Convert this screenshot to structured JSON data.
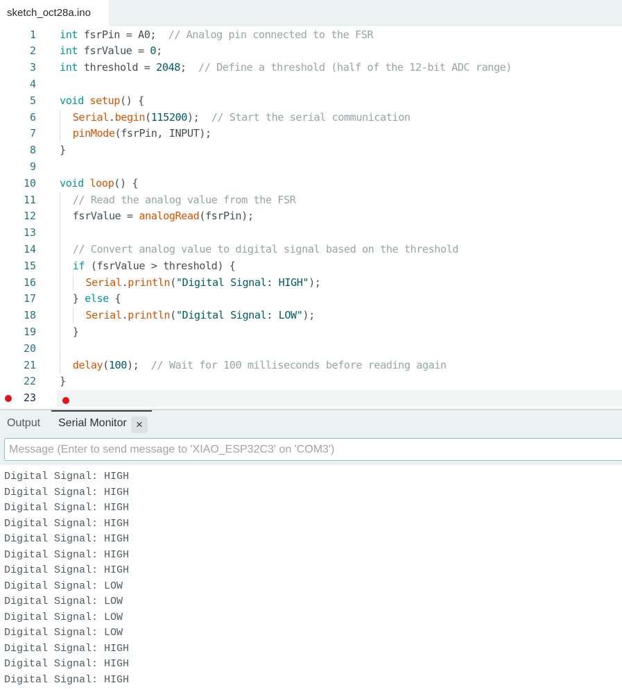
{
  "file_tab": {
    "label": "sketch_oct28a.ino"
  },
  "editor": {
    "active_line": 23,
    "breakpoint_line": 23,
    "lines": [
      {
        "n": "1",
        "tokens": [
          [
            "kw",
            "int"
          ],
          [
            "plain",
            " fsrPin = A0;  "
          ],
          [
            "cm",
            "// Analog pin connected to the FSR"
          ]
        ]
      },
      {
        "n": "2",
        "tokens": [
          [
            "kw",
            "int"
          ],
          [
            "plain",
            " fsrValue = "
          ],
          [
            "num",
            "0"
          ],
          [
            "plain",
            ";"
          ]
        ]
      },
      {
        "n": "3",
        "tokens": [
          [
            "kw",
            "int"
          ],
          [
            "plain",
            " threshold = "
          ],
          [
            "num",
            "2048"
          ],
          [
            "plain",
            ";  "
          ],
          [
            "cm",
            "// Define a threshold (half of the 12-bit ADC range)"
          ]
        ]
      },
      {
        "n": "4",
        "tokens": []
      },
      {
        "n": "5",
        "tokens": [
          [
            "kw",
            "void"
          ],
          [
            "plain",
            " "
          ],
          [
            "fn",
            "setup"
          ],
          [
            "plain",
            "() {"
          ]
        ]
      },
      {
        "n": "6",
        "indent": 1,
        "tokens": [
          [
            "fn",
            "Serial"
          ],
          [
            "plain",
            "."
          ],
          [
            "fn",
            "begin"
          ],
          [
            "plain",
            "("
          ],
          [
            "num",
            "115200"
          ],
          [
            "plain",
            ");  "
          ],
          [
            "cm",
            "// Start the serial communication"
          ]
        ]
      },
      {
        "n": "7",
        "indent": 1,
        "tokens": [
          [
            "fn",
            "pinMode"
          ],
          [
            "plain",
            "(fsrPin, INPUT);"
          ]
        ]
      },
      {
        "n": "8",
        "tokens": [
          [
            "plain",
            "}"
          ]
        ]
      },
      {
        "n": "9",
        "tokens": []
      },
      {
        "n": "10",
        "tokens": [
          [
            "kw",
            "void"
          ],
          [
            "plain",
            " "
          ],
          [
            "fn",
            "loop"
          ],
          [
            "plain",
            "() {"
          ]
        ]
      },
      {
        "n": "11",
        "indent": 1,
        "tokens": [
          [
            "cm",
            "// Read the analog value from the FSR"
          ]
        ]
      },
      {
        "n": "12",
        "indent": 1,
        "tokens": [
          [
            "plain",
            "fsrValue = "
          ],
          [
            "fn",
            "analogRead"
          ],
          [
            "plain",
            "(fsrPin);"
          ]
        ]
      },
      {
        "n": "13",
        "indent": 1,
        "tokens": []
      },
      {
        "n": "14",
        "indent": 1,
        "tokens": [
          [
            "cm",
            "// Convert analog value to digital signal based on the threshold"
          ]
        ]
      },
      {
        "n": "15",
        "indent": 1,
        "tokens": [
          [
            "kw",
            "if"
          ],
          [
            "plain",
            " (fsrValue > threshold) {"
          ]
        ]
      },
      {
        "n": "16",
        "indent": 2,
        "tokens": [
          [
            "fn",
            "Serial"
          ],
          [
            "plain",
            "."
          ],
          [
            "fn",
            "println"
          ],
          [
            "plain",
            "("
          ],
          [
            "str",
            "\"Digital Signal: HIGH\""
          ],
          [
            "plain",
            ");"
          ]
        ]
      },
      {
        "n": "17",
        "indent": 1,
        "tokens": [
          [
            "plain",
            "} "
          ],
          [
            "kw",
            "else"
          ],
          [
            "plain",
            " {"
          ]
        ]
      },
      {
        "n": "18",
        "indent": 2,
        "tokens": [
          [
            "fn",
            "Serial"
          ],
          [
            "plain",
            "."
          ],
          [
            "fn",
            "println"
          ],
          [
            "plain",
            "("
          ],
          [
            "str",
            "\"Digital Signal: LOW\""
          ],
          [
            "plain",
            ");"
          ]
        ]
      },
      {
        "n": "19",
        "indent": 1,
        "tokens": [
          [
            "plain",
            "}"
          ]
        ]
      },
      {
        "n": "20",
        "indent": 1,
        "tokens": []
      },
      {
        "n": "21",
        "indent": 1,
        "tokens": [
          [
            "fn",
            "delay"
          ],
          [
            "plain",
            "("
          ],
          [
            "num",
            "100"
          ],
          [
            "plain",
            ");  "
          ],
          [
            "cm",
            "// Wait for 100 milliseconds before reading again"
          ]
        ]
      },
      {
        "n": "22",
        "tokens": [
          [
            "plain",
            "}"
          ]
        ]
      },
      {
        "n": "23",
        "tokens": []
      }
    ]
  },
  "panel": {
    "tabs": {
      "output": "Output",
      "serial_monitor": "Serial Monitor"
    },
    "active_tab": "serial_monitor",
    "close_icon": "×",
    "message_input": {
      "value": "",
      "placeholder": "Message (Enter to send message to 'XIAO_ESP32C3' on 'COM3')"
    },
    "serial_output": [
      "Digital Signal: HIGH",
      "Digital Signal: HIGH",
      "Digital Signal: HIGH",
      "Digital Signal: HIGH",
      "Digital Signal: HIGH",
      "Digital Signal: HIGH",
      "Digital Signal: HIGH",
      "Digital Signal: LOW",
      "Digital Signal: LOW",
      "Digital Signal: LOW",
      "Digital Signal: LOW",
      "Digital Signal: HIGH",
      "Digital Signal: HIGH",
      "Digital Signal: HIGH"
    ]
  },
  "colors": {
    "keyword": "#00979c",
    "function": "#d35400",
    "comment": "#95a5a6",
    "number_string": "#005c5f",
    "breakpoint": "#e3111b",
    "line_number": "#2a7285"
  }
}
